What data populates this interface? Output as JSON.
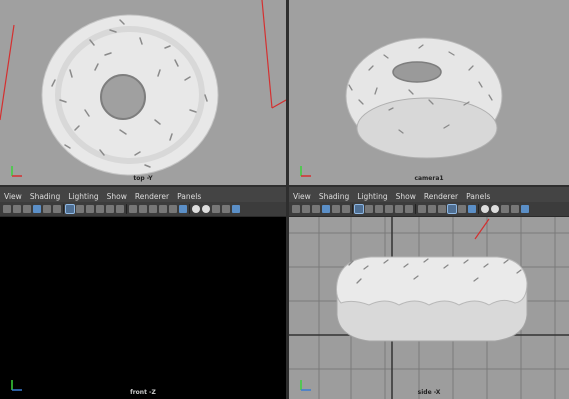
{
  "menu": [
    "View",
    "Shading",
    "Lighting",
    "Show",
    "Renderer",
    "Panels"
  ],
  "panes": {
    "top_left": {
      "label": "top -Y"
    },
    "top_right": {
      "label": "camera1"
    },
    "bottom_left": {
      "label": "front -Z"
    },
    "bottom_right": {
      "label": "side -X"
    }
  },
  "colors": {
    "viewport_gray": "#a0a0a0",
    "viewport_black": "#000000",
    "camera_line_red": "#d43030",
    "grid_line": "#7a7a7a"
  },
  "icons": [
    "camera-icon",
    "select-icon",
    "grid-icon",
    "wireframe-icon",
    "shaded-icon",
    "light-icon",
    "isolate-icon",
    "xray-icon"
  ]
}
